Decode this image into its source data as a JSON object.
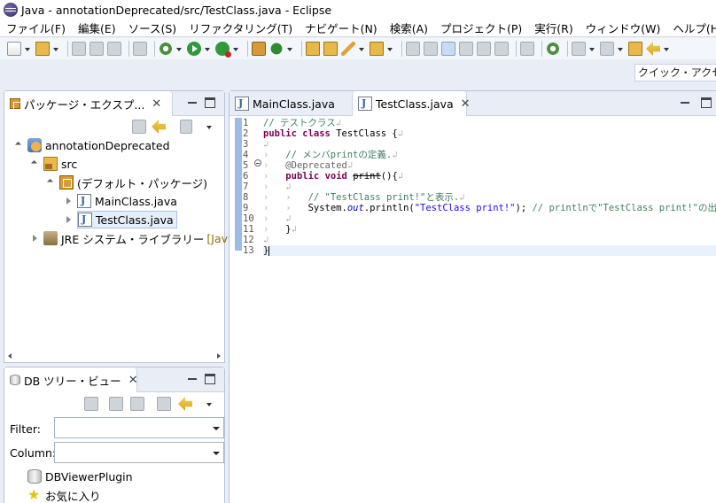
{
  "window": {
    "title": "Java - annotationDeprecated/src/TestClass.java - Eclipse"
  },
  "menu": [
    "ファイル(F)",
    "編集(E)",
    "ソース(S)",
    "リファクタリング(T)",
    "ナビゲート(N)",
    "検索(A)",
    "プロジェクト(P)",
    "実行(R)",
    "ウィンドウ(W)",
    "ヘルプ(H)"
  ],
  "quick_access": "クイック・アクセス",
  "package_explorer": {
    "tab_label": "パッケージ・エクスプ...",
    "tree": {
      "project": "annotationDeprecated",
      "src": "src",
      "default_package": "(デフォルト・パッケージ)",
      "file1": "MainClass.java",
      "file2": "TestClass.java",
      "jre": "JRE システム・ライブラリー",
      "jre_suffix": "[Jav"
    }
  },
  "db_view": {
    "tab_label": "DB ツリー・ビュー",
    "filter_label": "Filter:",
    "column_label": "Column:",
    "filter_value": "",
    "column_value": "",
    "items": [
      "DBViewerPlugin",
      "お気に入り"
    ]
  },
  "editor": {
    "tabs": [
      "MainClass.java",
      "TestClass.java"
    ],
    "active_tab": "TestClass.java",
    "line_numbers": [
      "1",
      "2",
      "3",
      "4",
      "5",
      "6",
      "7",
      "8",
      "9",
      "10",
      "11",
      "12",
      "13"
    ],
    "code": {
      "l1_comment": "// テストクラス",
      "l2_kw1": "public",
      "l2_kw2": "class",
      "l2_name": " TestClass {",
      "l4_comment": "// メンバprintの定義.",
      "l5_annotation": "@Deprecated",
      "l6_kw1": "public",
      "l6_kw2": "void",
      "l6_method": "print",
      "l6_rest": "(){",
      "l8_comment": "// \"TestClass print!\"と表示.",
      "l9_sys": "System.",
      "l9_out": "out",
      "l9_call": ".println(",
      "l9_str": "\"TestClass print!\"",
      "l9_end": "); ",
      "l9_comment": "// printlnで\"TestClass print!\"の出",
      "l11_brace": "}",
      "l13_brace": "}"
    }
  },
  "colors": {
    "keyword": "#7f0055",
    "comment": "#3f7f5f",
    "string": "#2a00ff",
    "annotation": "#646464",
    "field": "#0000c0",
    "current_line": "#e8f2fe",
    "selection_tree": "#e5eef9"
  }
}
